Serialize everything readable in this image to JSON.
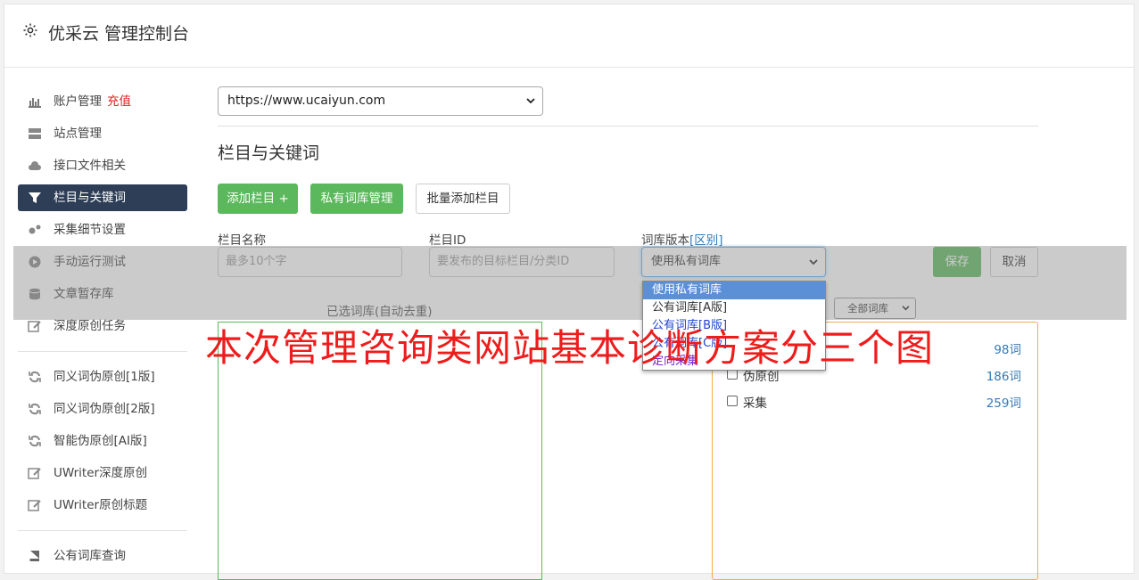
{
  "header": {
    "title": "优采云 管理控制台",
    "icon": "gear-icon"
  },
  "sidebar": {
    "items": [
      {
        "label": "账户管理",
        "extra": "充值",
        "icon": "bar-chart-icon"
      },
      {
        "label": "站点管理",
        "icon": "server-icon"
      },
      {
        "label": "接口文件相关",
        "icon": "cloud-upload-icon"
      },
      {
        "label": "栏目与关键词",
        "icon": "filter-icon",
        "active": true
      },
      {
        "label": "采集细节设置",
        "icon": "gears-icon"
      },
      {
        "label": "手动运行测试",
        "icon": "play-circle-icon"
      },
      {
        "label": "文章暂存库",
        "icon": "database-icon"
      },
      {
        "label": "深度原创任务",
        "icon": "edit-icon"
      },
      {
        "label": "同义词伪原创[1版]",
        "icon": "refresh-icon"
      },
      {
        "label": "同义词伪原创[2版]",
        "icon": "refresh-icon"
      },
      {
        "label": "智能伪原创[AI版]",
        "icon": "refresh-icon"
      },
      {
        "label": "UWriter深度原创",
        "icon": "edit-icon"
      },
      {
        "label": "UWriter原创标题",
        "icon": "edit-icon"
      },
      {
        "label": "公有词库查询",
        "icon": "book-icon"
      }
    ]
  },
  "main": {
    "site_select": "https://www.ucaiyun.com",
    "section_title": "栏目与关键词",
    "buttons": {
      "add_column": "添加栏目 +",
      "private_lib": "私有词库管理",
      "batch_add": "批量添加栏目",
      "save": "保存",
      "cancel": "取消"
    },
    "form": {
      "column_name_label": "栏目名称",
      "column_name_placeholder": "最多10个字",
      "column_id_label": "栏目ID",
      "column_id_placeholder": "要发布的目标栏目/分类ID",
      "lib_version_label": "词库版本",
      "lib_version_link": "[区别]",
      "lib_version_value": "使用私有词库"
    },
    "dropdown_options": [
      "使用私有词库",
      "公有词库[A版]",
      "公有词库[B版]",
      "公有词库[C版]",
      "定向采集"
    ],
    "selected_lib_label": "已选词库(自动去重)",
    "all_lib_select": "全部词库",
    "libs": [
      {
        "name": "",
        "count": "98词"
      },
      {
        "name": "伪原创",
        "count": "186词"
      },
      {
        "name": "采集",
        "count": "259词"
      }
    ]
  },
  "watermark": "本次管理咨询类网站基本诊断方案分三个图"
}
